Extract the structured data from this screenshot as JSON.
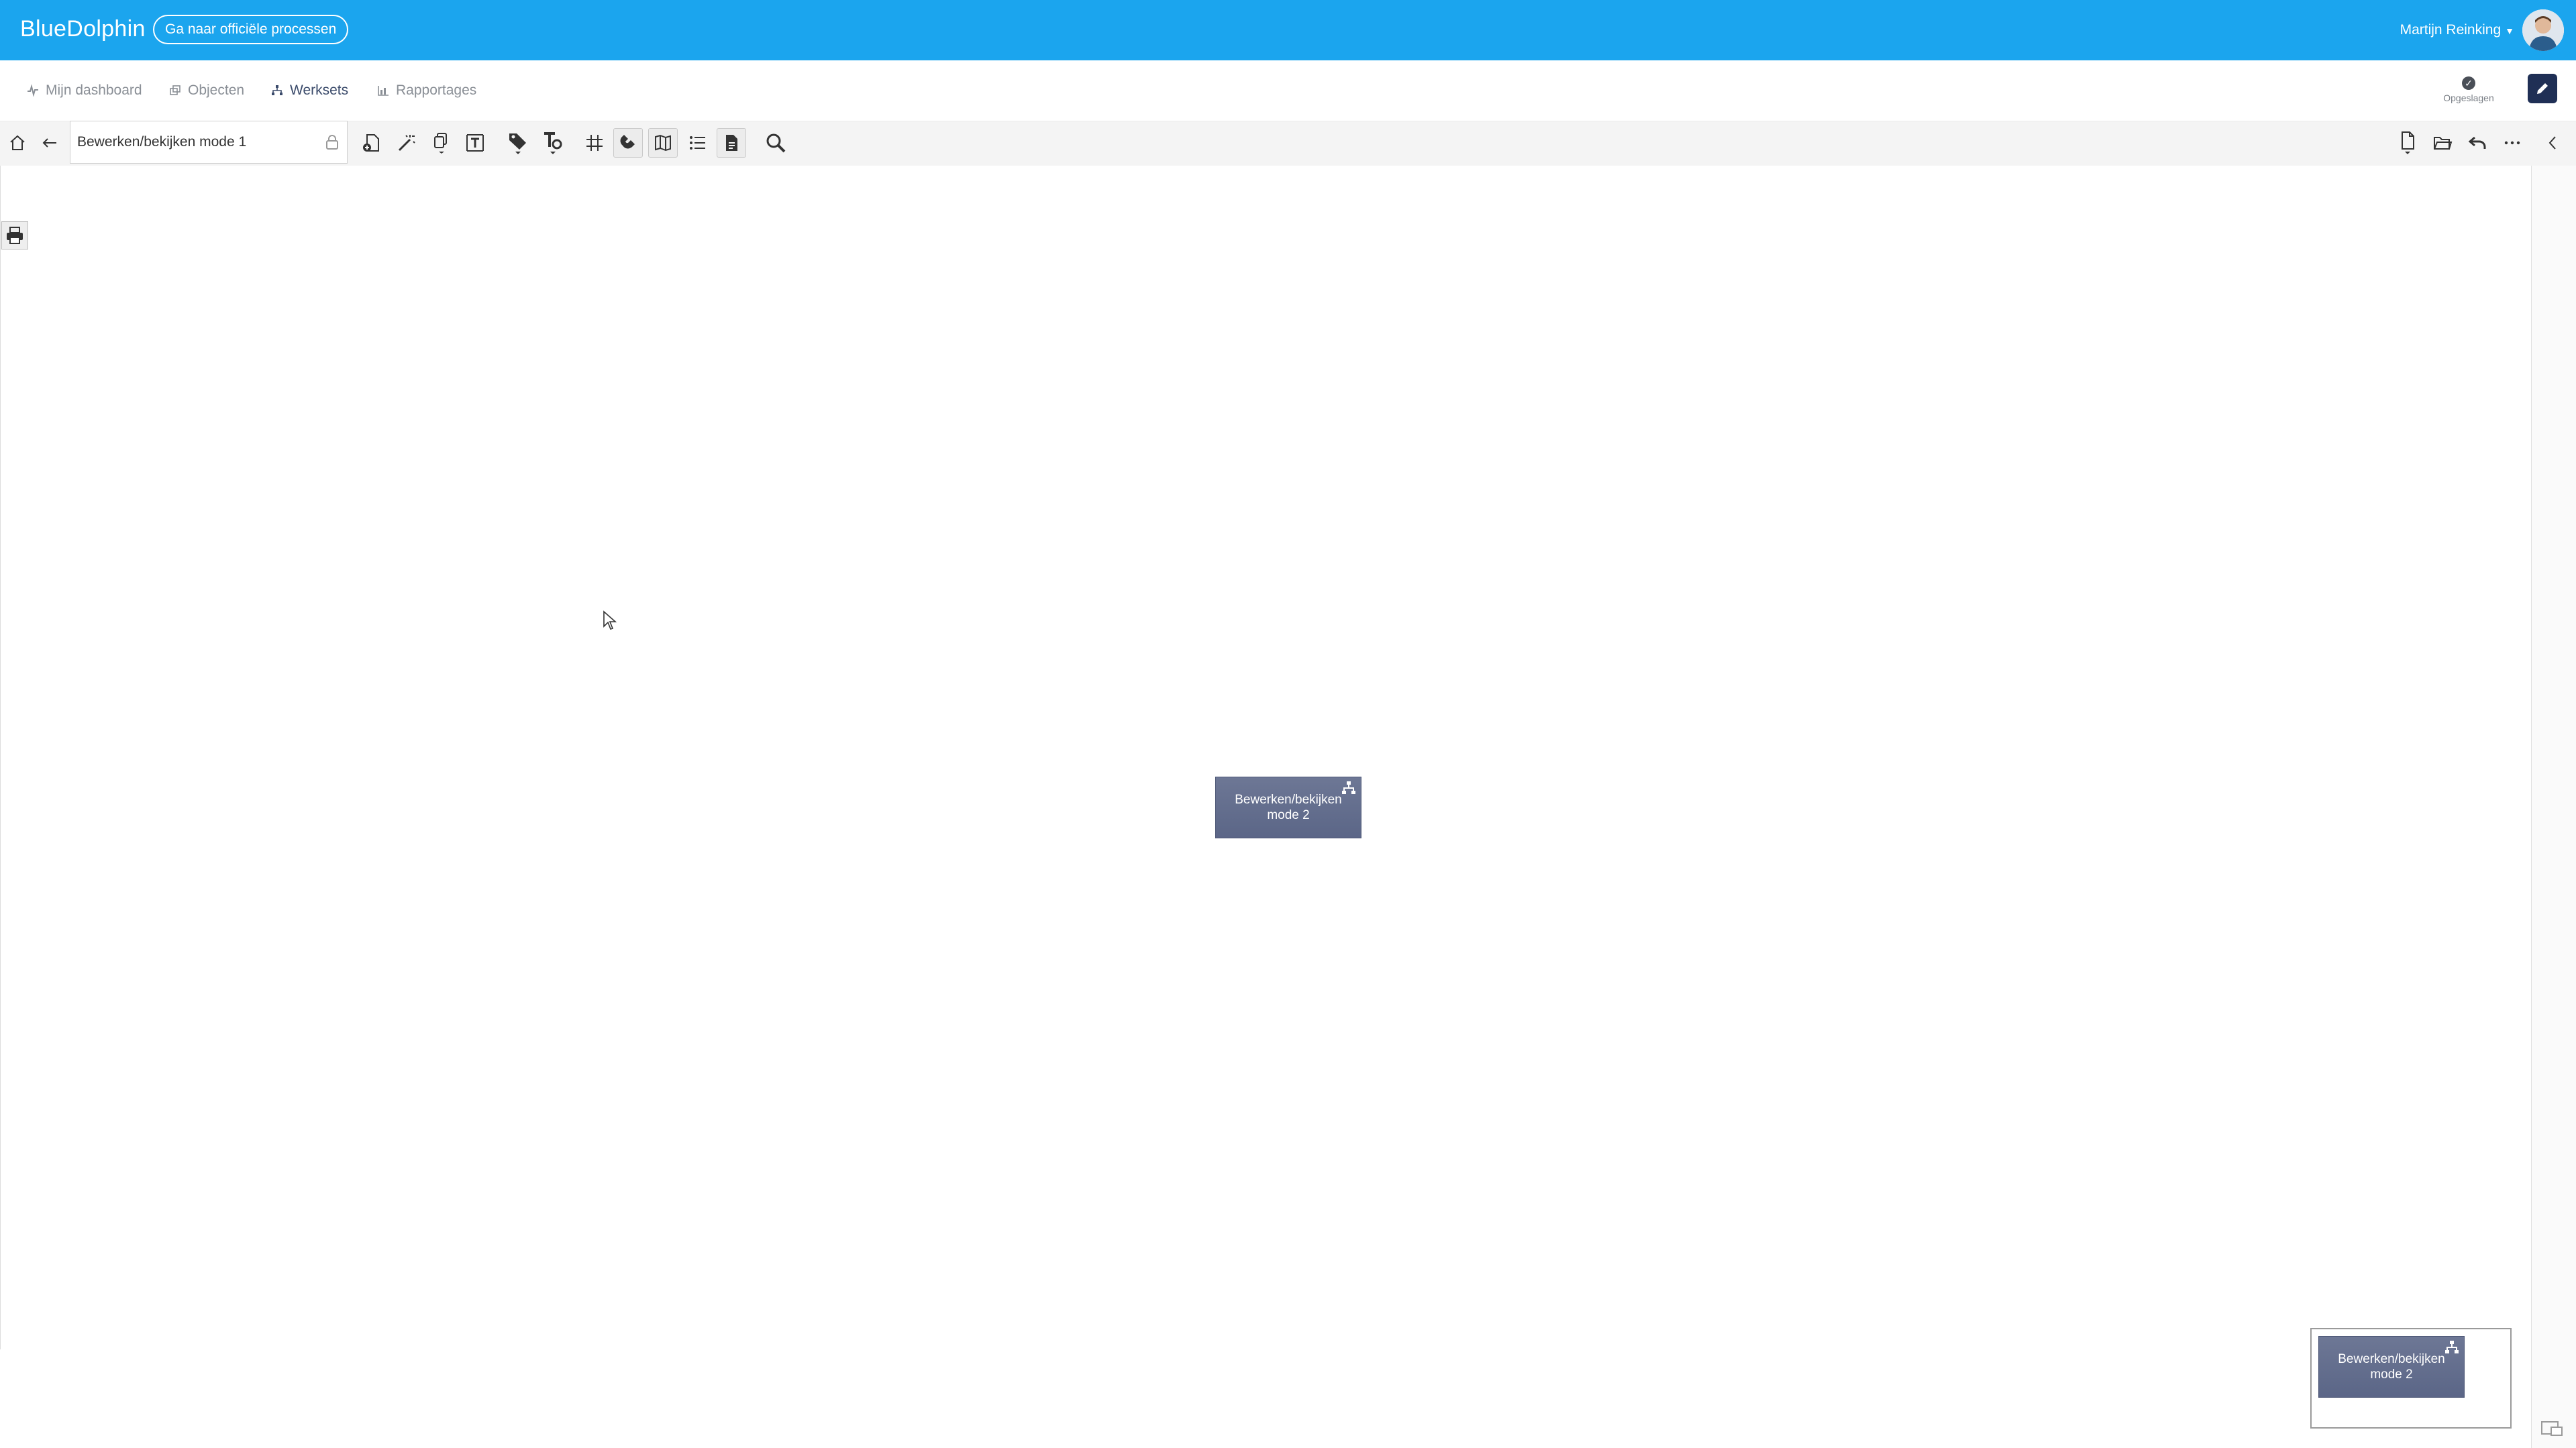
{
  "header": {
    "brand": "BlueDolphin",
    "official_link": "Ga naar officiële processen",
    "user_name": "Martijn Reinking",
    "brand_color": "#1ba5ee"
  },
  "nav": {
    "items": [
      {
        "label": "Mijn dashboard",
        "icon": "pulse-icon",
        "active": false
      },
      {
        "label": "Objecten",
        "icon": "objects-icon",
        "active": false
      },
      {
        "label": "Werksets",
        "icon": "hierarchy-icon",
        "active": true
      },
      {
        "label": "Rapportages",
        "icon": "bar-chart-icon",
        "active": false
      }
    ],
    "saved_label": "Opgeslagen"
  },
  "toolbar": {
    "title_value": "Bewerken/bekijken mode 1"
  },
  "canvas": {
    "node_label": "Bewerken/bekijken mode 2",
    "node_color": "#6d7795"
  },
  "minimap": {
    "node_label": "Bewerken/bekijken mode 2"
  }
}
